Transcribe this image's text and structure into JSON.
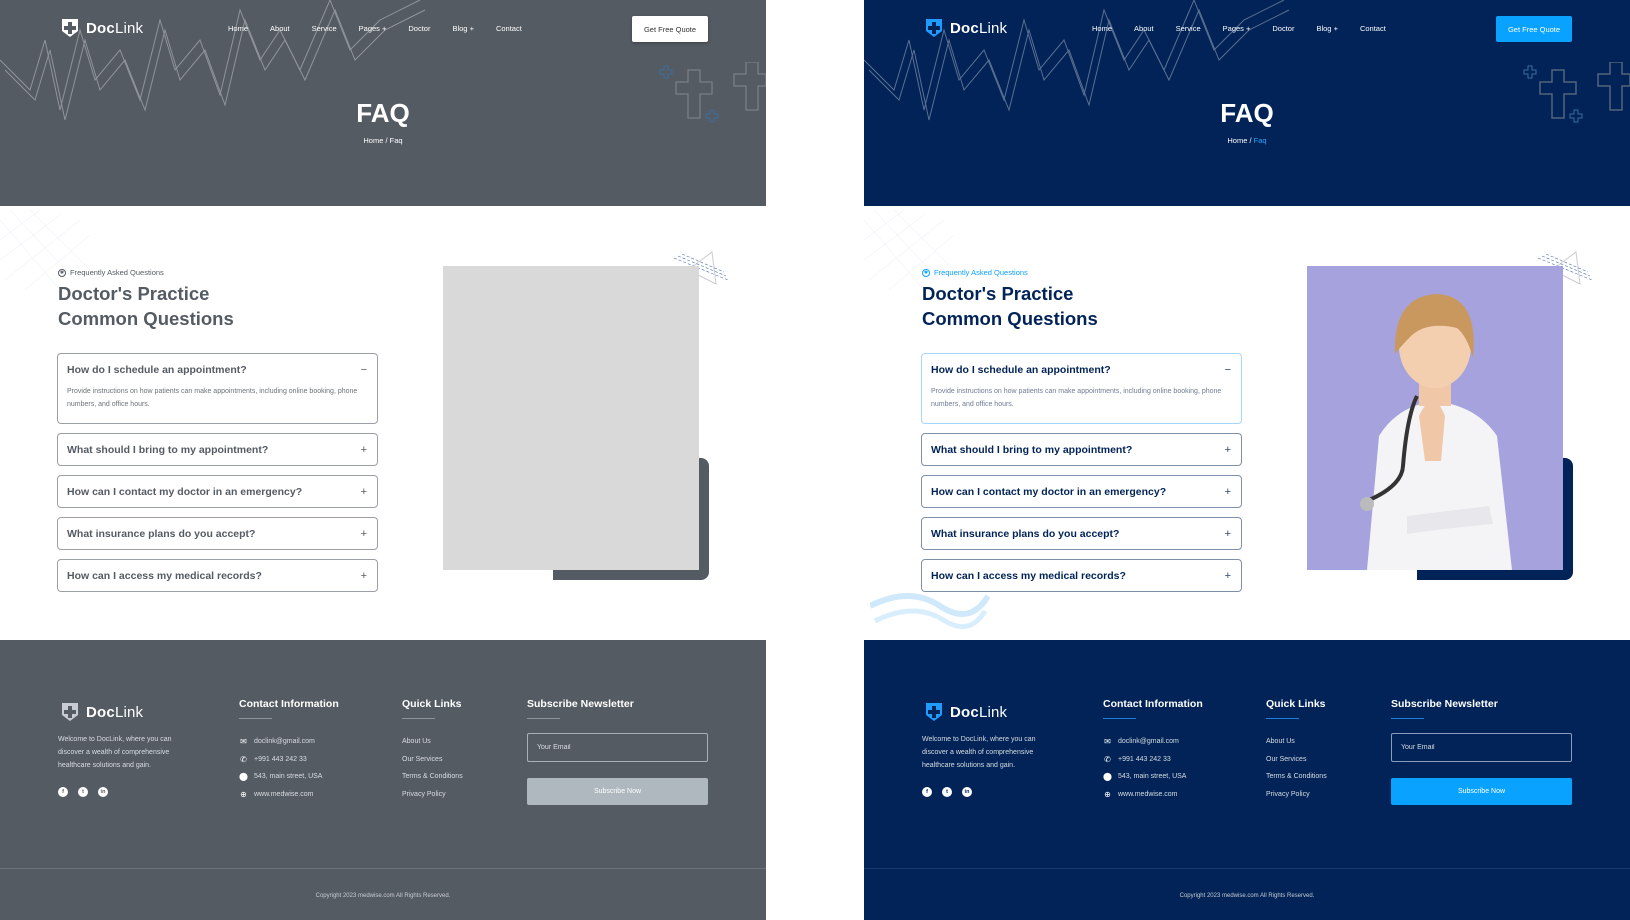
{
  "brand": {
    "name_bold": "Doc",
    "name_light": "Link"
  },
  "nav": {
    "items": [
      "Home",
      "About",
      "Service",
      "Pages +",
      "Doctor",
      "Blog +",
      "Contact"
    ],
    "cta": "Get Free Quote"
  },
  "hero": {
    "title": "FAQ",
    "breadcrumb_home": "Home",
    "breadcrumb_sep": " / ",
    "breadcrumb_current": "Faq"
  },
  "faq": {
    "eyebrow": "Frequently Asked Questions",
    "title_line1": "Doctor's Practice",
    "title_line2": "Common Questions",
    "items": [
      {
        "question": "How do I schedule an appointment?",
        "answer": "Provide instructions on how patients can make appointments, including online booking, phone numbers, and office hours.",
        "expanded": true,
        "sign": "−"
      },
      {
        "question": "What should I bring to my appointment?",
        "expanded": false,
        "sign": "+"
      },
      {
        "question": "How can I contact my doctor in an emergency?",
        "expanded": false,
        "sign": "+"
      },
      {
        "question": "What insurance plans do you accept?",
        "expanded": false,
        "sign": "+"
      },
      {
        "question": "How can I access my medical records?",
        "expanded": false,
        "sign": "+"
      }
    ]
  },
  "footer": {
    "about": "Welcome to DocLink, where you can discover a wealth of comprehensive healthcare solutions and gain.",
    "socials": [
      "facebook",
      "twitter",
      "linkedin"
    ],
    "contact": {
      "heading": "Contact Information",
      "email": "doclink@gmail.com",
      "phone": "+991 443 242 33",
      "address": "543, main street, USA",
      "website": "www.medwise.com"
    },
    "quick_links": {
      "heading": "Quick Links",
      "items": [
        "About Us",
        "Our Services",
        "Terms & Conditions",
        "Privacy Policy"
      ]
    },
    "newsletter": {
      "heading": "Subscribe Newsletter",
      "placeholder": "Your Email",
      "button": "Subscribe Now"
    },
    "copyright": "Copyright 2023 medwise.com All Rights Reserved."
  },
  "variants": {
    "left": {
      "theme": "grayscale wireframe",
      "accent": "#555b63"
    },
    "right": {
      "theme": "colored",
      "accent": "#0aa2ff",
      "navy": "#012357"
    }
  }
}
